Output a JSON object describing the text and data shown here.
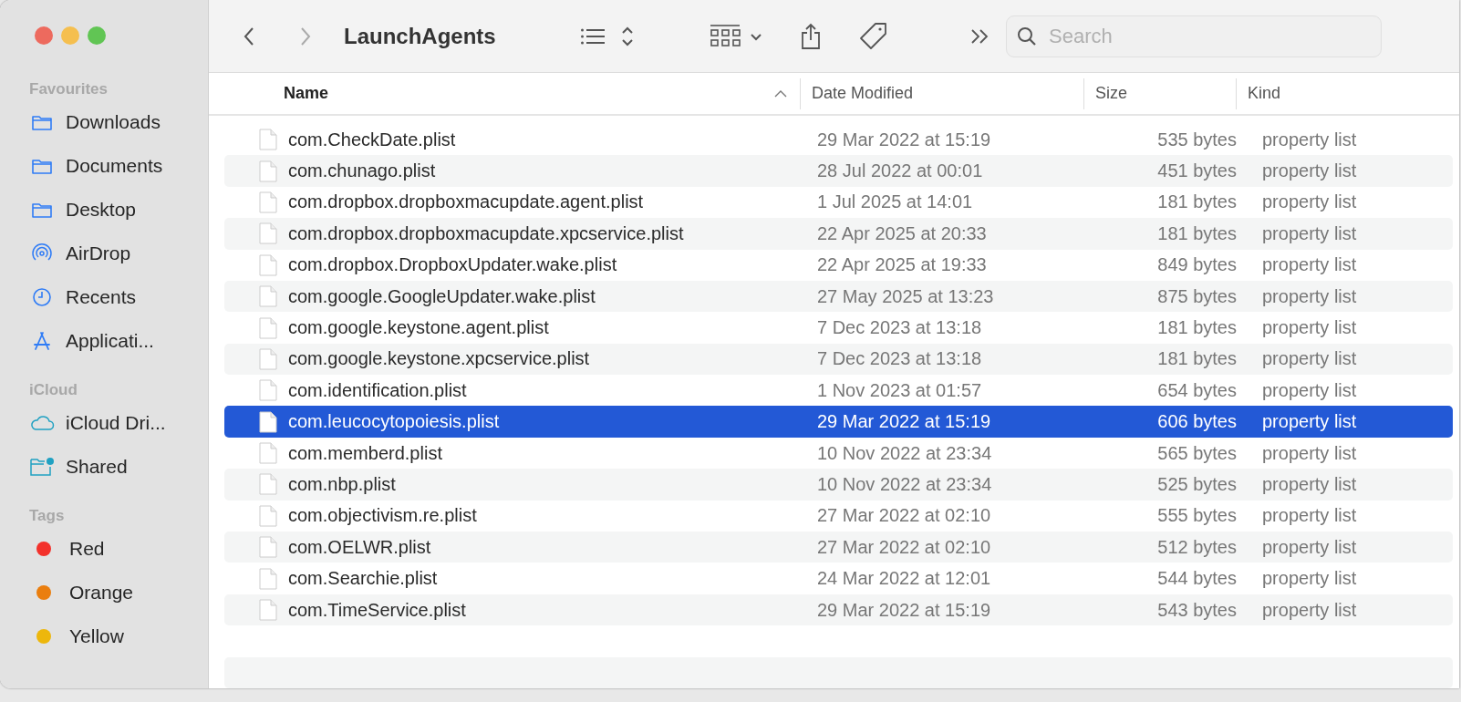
{
  "window": {
    "title": "LaunchAgents"
  },
  "toolbar": {
    "search": {
      "placeholder": "Search"
    }
  },
  "sidebar": {
    "sections": [
      {
        "title": "Favourites",
        "items": [
          {
            "kind": "folder",
            "label": "Downloads"
          },
          {
            "kind": "folder",
            "label": "Documents"
          },
          {
            "kind": "folder",
            "label": "Desktop"
          },
          {
            "kind": "airdrop",
            "label": "AirDrop"
          },
          {
            "kind": "clock",
            "label": "Recents"
          },
          {
            "kind": "apps",
            "label": "Applicati..."
          }
        ]
      },
      {
        "title": "iCloud",
        "items": [
          {
            "kind": "cloud",
            "label": "iCloud Dri..."
          },
          {
            "kind": "shared",
            "label": "Shared"
          }
        ]
      },
      {
        "title": "Tags",
        "items": [
          {
            "kind": "tag",
            "label": "Red",
            "color": "#f3312b"
          },
          {
            "kind": "tag",
            "label": "Orange",
            "color": "#ea7e0e"
          },
          {
            "kind": "tag",
            "label": "Yellow",
            "color": "#edb70c"
          }
        ]
      }
    ]
  },
  "table": {
    "columns": [
      {
        "label": "Name",
        "sorted": true
      },
      {
        "label": "Date Modified",
        "sorted": false
      },
      {
        "label": "Size",
        "sorted": false
      },
      {
        "label": "Kind",
        "sorted": false
      }
    ],
    "rows": [
      {
        "name": "com.CheckDate.plist",
        "date": "29 Mar 2022 at 15:19",
        "size": "535 bytes",
        "kind": "property list",
        "selected": false
      },
      {
        "name": "com.chunago.plist",
        "date": "28 Jul 2022 at 00:01",
        "size": "451 bytes",
        "kind": "property list",
        "selected": false
      },
      {
        "name": "com.dropbox.dropboxmacupdate.agent.plist",
        "date": "1 Jul 2025 at 14:01",
        "size": "181 bytes",
        "kind": "property list",
        "selected": false
      },
      {
        "name": "com.dropbox.dropboxmacupdate.xpcservice.plist",
        "date": "22 Apr 2025 at 20:33",
        "size": "181 bytes",
        "kind": "property list",
        "selected": false
      },
      {
        "name": "com.dropbox.DropboxUpdater.wake.plist",
        "date": "22 Apr 2025 at 19:33",
        "size": "849 bytes",
        "kind": "property list",
        "selected": false
      },
      {
        "name": "com.google.GoogleUpdater.wake.plist",
        "date": "27 May 2025 at 13:23",
        "size": "875 bytes",
        "kind": "property list",
        "selected": false
      },
      {
        "name": "com.google.keystone.agent.plist",
        "date": "7 Dec 2023 at 13:18",
        "size": "181 bytes",
        "kind": "property list",
        "selected": false
      },
      {
        "name": "com.google.keystone.xpcservice.plist",
        "date": "7 Dec 2023 at 13:18",
        "size": "181 bytes",
        "kind": "property list",
        "selected": false
      },
      {
        "name": "com.identification.plist",
        "date": "1 Nov 2023 at 01:57",
        "size": "654 bytes",
        "kind": "property list",
        "selected": false
      },
      {
        "name": "com.leucocytopoiesis.plist",
        "date": "29 Mar 2022 at 15:19",
        "size": "606 bytes",
        "kind": "property list",
        "selected": true
      },
      {
        "name": "com.memberd.plist",
        "date": "10 Nov 2022 at 23:34",
        "size": "565 bytes",
        "kind": "property list",
        "selected": false
      },
      {
        "name": "com.nbp.plist",
        "date": "10 Nov 2022 at 23:34",
        "size": "525 bytes",
        "kind": "property list",
        "selected": false
      },
      {
        "name": "com.objectivism.re.plist",
        "date": "27 Mar 2022 at 02:10",
        "size": "555 bytes",
        "kind": "property list",
        "selected": false
      },
      {
        "name": "com.OELWR.plist",
        "date": "27 Mar 2022 at 02:10",
        "size": "512 bytes",
        "kind": "property list",
        "selected": false
      },
      {
        "name": "com.Searchie.plist",
        "date": "24 Mar 2022 at 12:01",
        "size": "544 bytes",
        "kind": "property list",
        "selected": false
      },
      {
        "name": "com.TimeService.plist",
        "date": "29 Mar 2022 at 15:19",
        "size": "543 bytes",
        "kind": "property list",
        "selected": false
      }
    ]
  }
}
